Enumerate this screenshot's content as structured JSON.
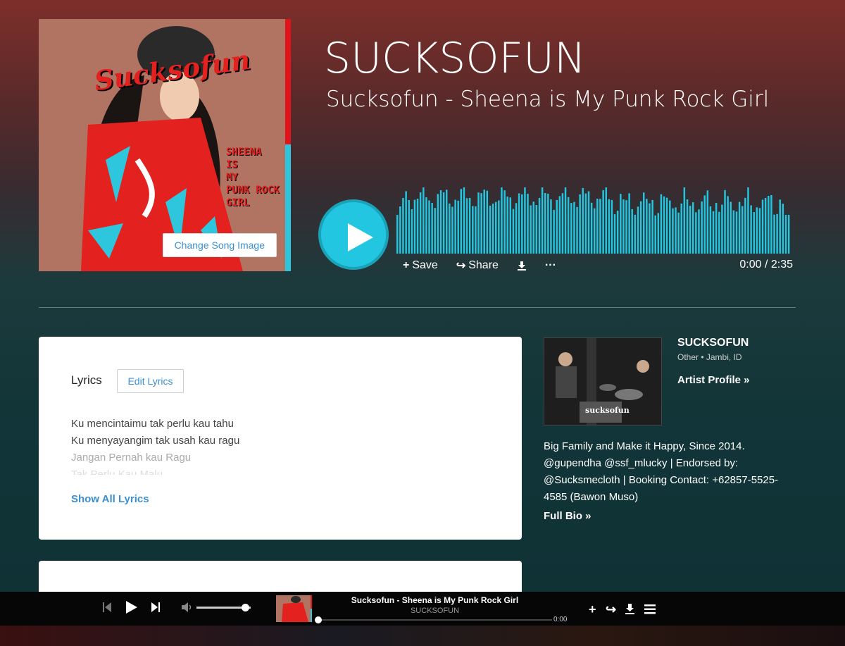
{
  "header": {
    "artist_title": "SUCKSOFUN",
    "song_title": "Sucksofun - Sheena is My Punk Rock Girl",
    "change_image_label": "Change Song Image",
    "cover_text": {
      "logo": "Sucksofun",
      "side_text": [
        "SHEENA",
        "IS",
        "MY",
        "PUNK ROCK",
        "GIRL"
      ]
    }
  },
  "player": {
    "actions": {
      "save": "Save",
      "share": "Share"
    },
    "time": "0:00 / 2:35",
    "accent_color": "#22c6e0"
  },
  "lyrics": {
    "label": "Lyrics",
    "edit_label": "Edit Lyrics",
    "lines": [
      "Ku mencintaimu tak perlu kau tahu",
      "Ku menyayangim tak usah kau ragu",
      "Jangan Pernah kau Ragu",
      "Tak Perlu Kau Malu"
    ],
    "show_all": "Show All Lyrics"
  },
  "artist": {
    "name": "SUCKSOFUN",
    "meta": "Other • Jambi, ID",
    "profile_link": "Artist Profile »",
    "bio": "Big Family and Make it Happy, Since 2014. @gupendha @ssf_mlucky | Endorsed by: @Sucksmecloth | Booking Contact: +62857-5525-4585 (Bawon Muso)",
    "full_bio": "Full Bio »",
    "photo_caption": "sucksofun"
  },
  "mini_player": {
    "title": "Sucksofun - Sheena is My Punk Rock Girl",
    "artist": "SUCKSOFUN",
    "time": "0:00",
    "volume": 0.9,
    "progress": 0
  }
}
